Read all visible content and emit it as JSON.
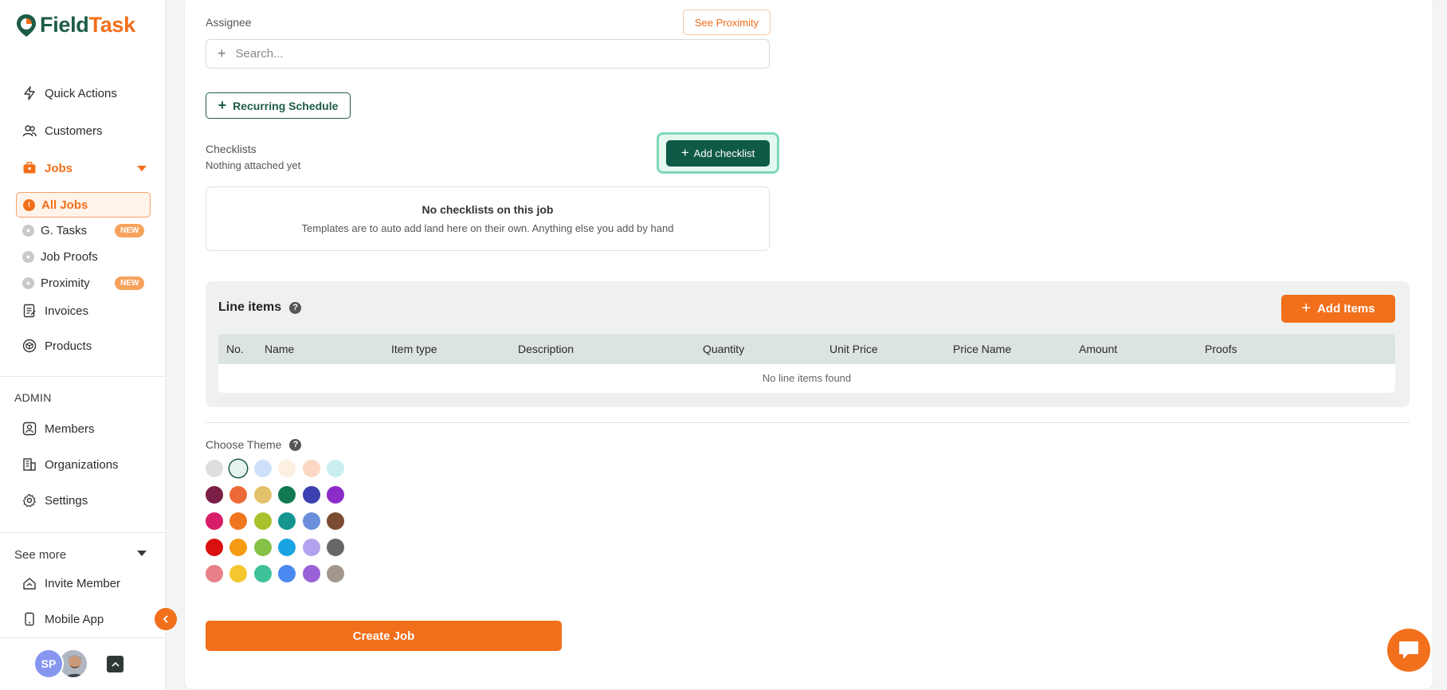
{
  "brand": {
    "field": "Field",
    "task": "Task"
  },
  "nav": {
    "quick_actions": "Quick Actions",
    "customers": "Customers",
    "jobs": "Jobs",
    "sub": {
      "all_jobs": "All Jobs",
      "g_tasks": "G. Tasks",
      "job_proofs": "Job Proofs",
      "proximity": "Proximity"
    },
    "new_badge": "NEW",
    "invoices": "Invoices",
    "products": "Products",
    "admin_label": "ADMIN",
    "members": "Members",
    "organizations": "Organizations",
    "settings": "Settings",
    "see_more": "See more",
    "invite_member": "Invite Member",
    "mobile_app": "Mobile App"
  },
  "user": {
    "initials": "SP"
  },
  "form": {
    "assignee_label": "Assignee",
    "see_proximity": "See Proximity",
    "search_placeholder": "Search...",
    "recurring_schedule": "Recurring Schedule",
    "checklists_label": "Checklists",
    "checklists_sub": "Nothing attached yet",
    "add_checklist": "Add checklist",
    "checklist_empty_title": "No checklists on this job",
    "checklist_empty_desc": "Templates are to auto add land here on their own. Anything else you add by hand"
  },
  "line_items": {
    "title": "Line items",
    "help": "?",
    "add_items": "Add Items",
    "columns": [
      "No.",
      "Name",
      "Item type",
      "Description",
      "Quantity",
      "Unit Price",
      "Price Name",
      "Amount",
      "Proofs"
    ],
    "empty": "No line items found"
  },
  "theme": {
    "label": "Choose Theme",
    "help": "?",
    "swatches": [
      [
        "#dedede",
        "#e6f4f1",
        "#cfe0fb",
        "#fdf0e0",
        "#fcd8c4",
        "#c9eff1"
      ],
      [
        "#7b1f46",
        "#ec6a37",
        "#e2c26a",
        "#127a50",
        "#3c40b0",
        "#8b2bc8"
      ],
      [
        "#d81e68",
        "#f0771f",
        "#a8c22e",
        "#149590",
        "#6c8fdb",
        "#7b4b32"
      ],
      [
        "#d91010",
        "#f59c14",
        "#86c148",
        "#1aa3e2",
        "#b4a2ee",
        "#676767"
      ],
      [
        "#e8808a",
        "#f5c72e",
        "#3ec29a",
        "#4a8af0",
        "#9a62d6",
        "#a29890"
      ]
    ],
    "selected_index": 1
  },
  "create_job": "Create Job",
  "colors": {
    "brand_orange": "#f26f1b",
    "brand_green": "#1e5b49",
    "checklist_button": "#0f5a47"
  },
  "icons": {
    "quick_actions": "bolt-icon",
    "customers": "users-icon",
    "jobs": "briefcase-icon",
    "invoices": "invoice-icon",
    "products": "box-icon",
    "members": "member-icon",
    "organizations": "building-icon",
    "settings": "gear-icon",
    "invite_member": "invite-icon",
    "mobile_app": "phone-icon",
    "chat": "chat-icon"
  }
}
